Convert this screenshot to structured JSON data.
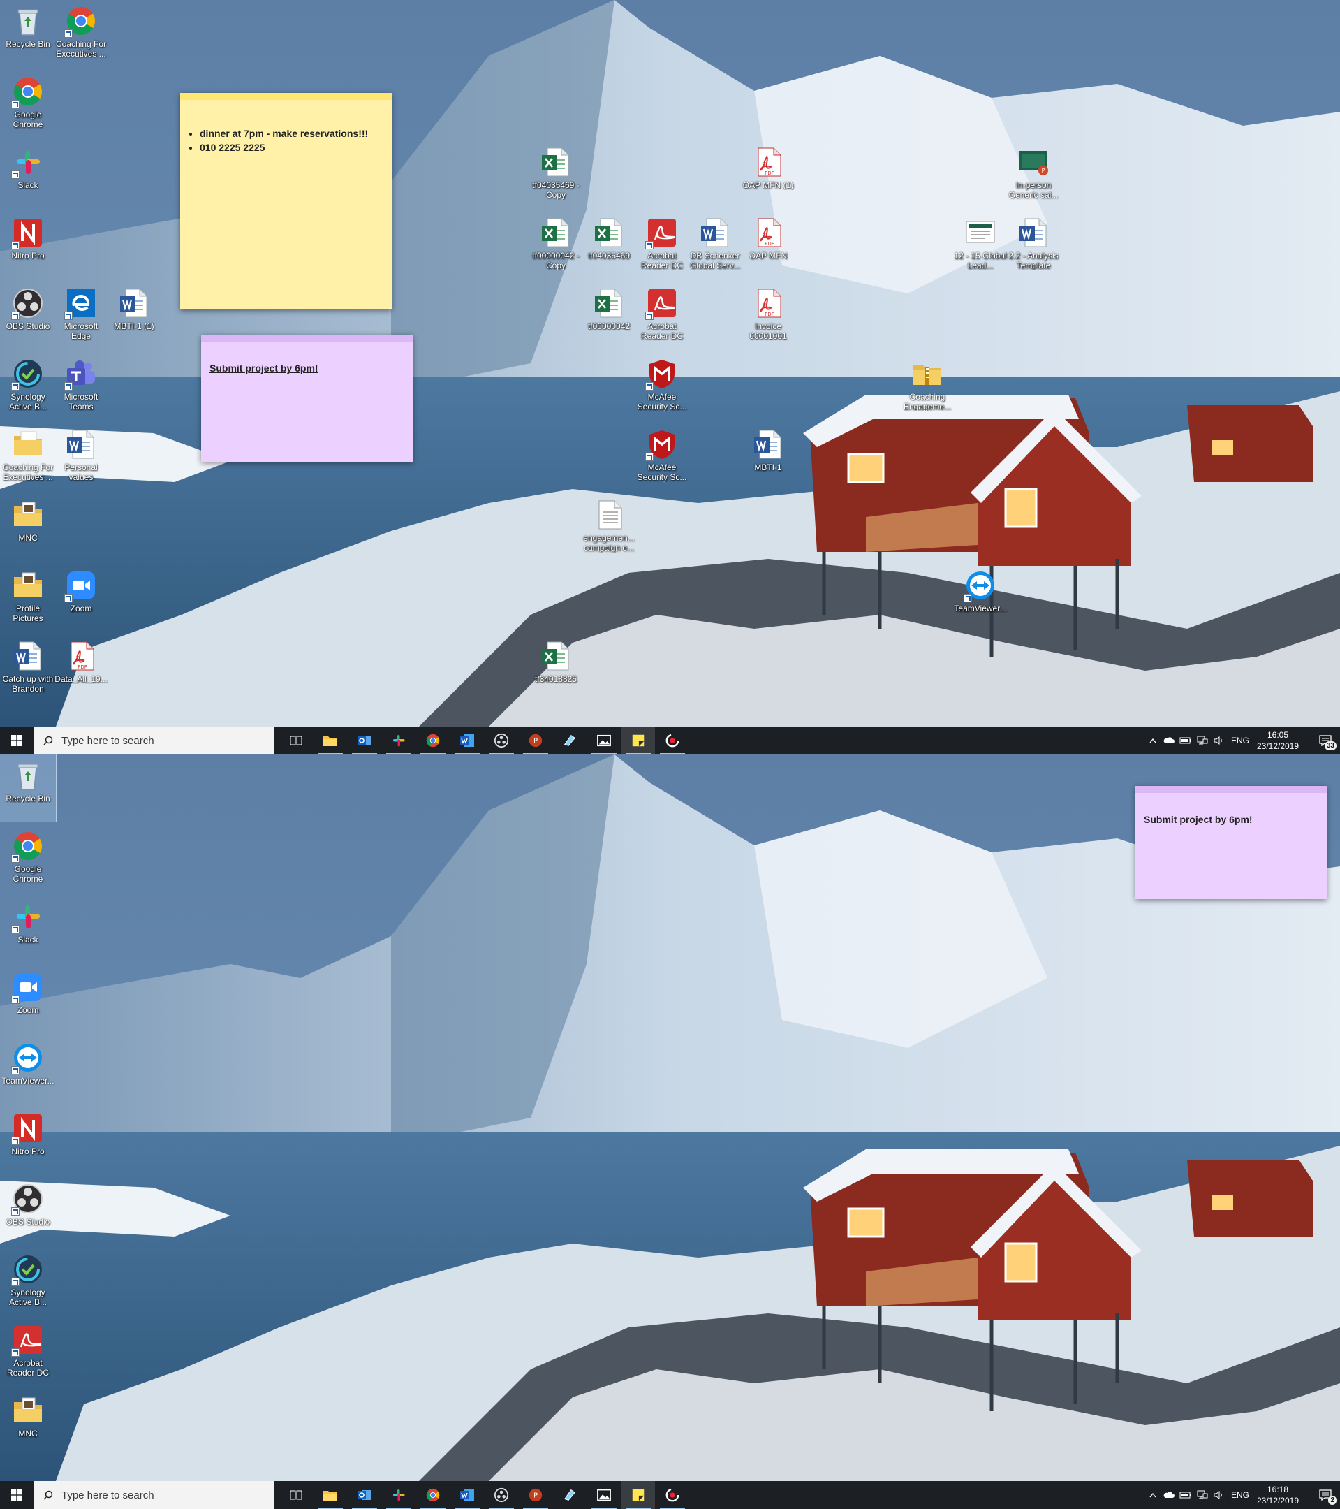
{
  "colors": {
    "sky": "#6f93b8",
    "mountain": "#c7d7e6",
    "water": "#2d5478",
    "snow": "#eef3f8",
    "cabin": "#8b2a1f",
    "taskbar": "#1c2024",
    "sticky_yellow": "#fff1a8",
    "sticky_purple": "#ecd0ff"
  },
  "screens": [
    {
      "icons": [
        {
          "label": "Recycle Bin",
          "type": "recycle"
        },
        {
          "label": "Coaching For Executives ...",
          "type": "chrome",
          "shortcut": true
        },
        {
          "label": "Google Chrome",
          "type": "chrome",
          "shortcut": true
        },
        {
          "label": "Slack",
          "type": "slack",
          "shortcut": true
        },
        {
          "label": "Nitro Pro",
          "type": "nitro",
          "shortcut": true
        },
        {
          "label": "OBS Studio",
          "type": "obs",
          "shortcut": true
        },
        {
          "label": "Microsoft Edge",
          "type": "edge",
          "shortcut": true
        },
        {
          "label": "MBTI-1 (1)",
          "type": "word"
        },
        {
          "label": "Synology Active B...",
          "type": "synology",
          "shortcut": true
        },
        {
          "label": "Microsoft Teams",
          "type": "teams",
          "shortcut": true
        },
        {
          "label": "Coaching For Executives ...",
          "type": "folder"
        },
        {
          "label": "Personal values",
          "type": "word"
        },
        {
          "label": "MNC",
          "type": "folderdoc"
        },
        {
          "label": "Profile Pictures",
          "type": "folderdoc"
        },
        {
          "label": "Zoom",
          "type": "zoom",
          "shortcut": true
        },
        {
          "label": "Catch up with Brandon",
          "type": "word"
        },
        {
          "label": "Data_All_19...",
          "type": "pdf"
        },
        {
          "label": "tf04035469 - Copy",
          "type": "excel"
        },
        {
          "label": "tf00000042 - Copy",
          "type": "excel"
        },
        {
          "label": "tf04035469",
          "type": "excel"
        },
        {
          "label": "tf00000042",
          "type": "excel"
        },
        {
          "label": "Acrobat Reader DC",
          "type": "acrobat",
          "shortcut": true
        },
        {
          "label": "Acrobat Reader DC",
          "type": "acrobat",
          "shortcut": true
        },
        {
          "label": "McAfee Security Sc...",
          "type": "mcafee",
          "shortcut": true
        },
        {
          "label": "McAfee Security Sc...",
          "type": "mcafee",
          "shortcut": true
        },
        {
          "label": "DB Schenker Global Serv...",
          "type": "word"
        },
        {
          "label": "OAP MFN (1)",
          "type": "pdf"
        },
        {
          "label": "OAP MFN",
          "type": "pdf"
        },
        {
          "label": "Invoice 00001001",
          "type": "pdf"
        },
        {
          "label": "MBTI-1",
          "type": "word"
        },
        {
          "label": "engagemen... campaign e...",
          "type": "text"
        },
        {
          "label": "tf34018825",
          "type": "excel"
        },
        {
          "label": "Coaching Engageme...",
          "type": "zip"
        },
        {
          "label": "TeamViewer...",
          "type": "teamviewer",
          "shortcut": true
        },
        {
          "label": "In-person Generic sal...",
          "type": "pptx"
        },
        {
          "label": "12 - 15 Global Lead...",
          "type": "slide"
        },
        {
          "label": "2.2 - Analysis Template",
          "type": "word"
        }
      ],
      "notes": [
        {
          "color": "yellow",
          "lines": [
            "dinner at 7pm - make reservations!!!",
            "010 2225 2225"
          ]
        },
        {
          "color": "purple",
          "heading": "Submit project by 6pm!"
        }
      ],
      "taskbar": {
        "search_placeholder": "Type here to search",
        "language": "ENG",
        "time": "16:05",
        "date": "23/12/2019",
        "notifications": "33"
      }
    },
    {
      "icons": [
        {
          "label": "Recycle Bin",
          "type": "recycle",
          "selected": true
        },
        {
          "label": "Google Chrome",
          "type": "chrome",
          "shortcut": true
        },
        {
          "label": "Slack",
          "type": "slack",
          "shortcut": true
        },
        {
          "label": "Zoom",
          "type": "zoom",
          "shortcut": true
        },
        {
          "label": "TeamViewer...",
          "type": "teamviewer",
          "shortcut": true
        },
        {
          "label": "Nitro Pro",
          "type": "nitro",
          "shortcut": true
        },
        {
          "label": "OBS Studio",
          "type": "obs",
          "shortcut": true
        },
        {
          "label": "Synology Active B...",
          "type": "synology",
          "shortcut": true
        },
        {
          "label": "Acrobat Reader DC",
          "type": "acrobat",
          "shortcut": true
        },
        {
          "label": "MNC",
          "type": "folderdoc"
        }
      ],
      "notes": [
        {
          "color": "purple",
          "heading": "Submit project by 6pm!"
        }
      ],
      "taskbar": {
        "search_placeholder": "Type here to search",
        "language": "ENG",
        "time": "16:18",
        "date": "23/12/2019",
        "notifications": "2"
      }
    }
  ],
  "taskbar_apps": [
    {
      "name": "task-view",
      "icon": "task-view-icon"
    },
    {
      "name": "file-explorer",
      "icon": "folder-icon",
      "running": true
    },
    {
      "name": "outlook",
      "icon": "outlook-icon",
      "running": true
    },
    {
      "name": "slack",
      "icon": "slack-icon",
      "running": true
    },
    {
      "name": "chrome",
      "icon": "chrome-icon",
      "running": true
    },
    {
      "name": "word",
      "icon": "word-icon",
      "running": true
    },
    {
      "name": "obs",
      "icon": "obs-icon",
      "running": true
    },
    {
      "name": "powerpoint",
      "icon": "powerpoint-icon",
      "running": true
    },
    {
      "name": "snipping",
      "icon": "snipping-icon"
    },
    {
      "name": "photos",
      "icon": "photos-icon",
      "running": true
    },
    {
      "name": "sticky-notes",
      "icon": "sticky-notes-icon",
      "running": true,
      "active": true
    },
    {
      "name": "recorder",
      "icon": "recorder-icon",
      "running": true
    }
  ]
}
